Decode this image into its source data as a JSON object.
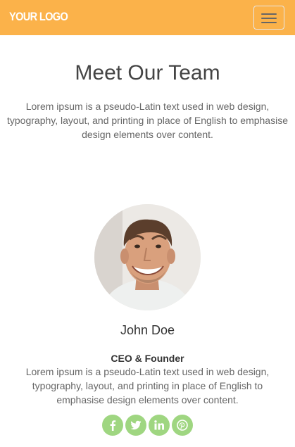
{
  "header": {
    "logo_text": "YOUR LOGO",
    "background_color": "#fbb24a",
    "menu_icon": "hamburger-menu-icon"
  },
  "main": {
    "title": "Meet Our Team",
    "intro": "Lorem ipsum is a pseudo-Latin text used in web design, typography, layout, and printing in place of English to emphasise design elements over content."
  },
  "member": {
    "name": "John Doe",
    "role": "CEO & Founder",
    "bio": "Lorem ipsum is a pseudo-Latin text used in web design, typography, layout, and printing in place of English to emphasise design elements over content.",
    "photo": "smiling-man-portrait",
    "socials": [
      {
        "network": "facebook",
        "icon": "facebook-icon"
      },
      {
        "network": "twitter",
        "icon": "twitter-icon"
      },
      {
        "network": "linkedin",
        "icon": "linkedin-icon"
      },
      {
        "network": "pinterest",
        "icon": "pinterest-icon"
      }
    ],
    "social_color": "#9fd681"
  }
}
